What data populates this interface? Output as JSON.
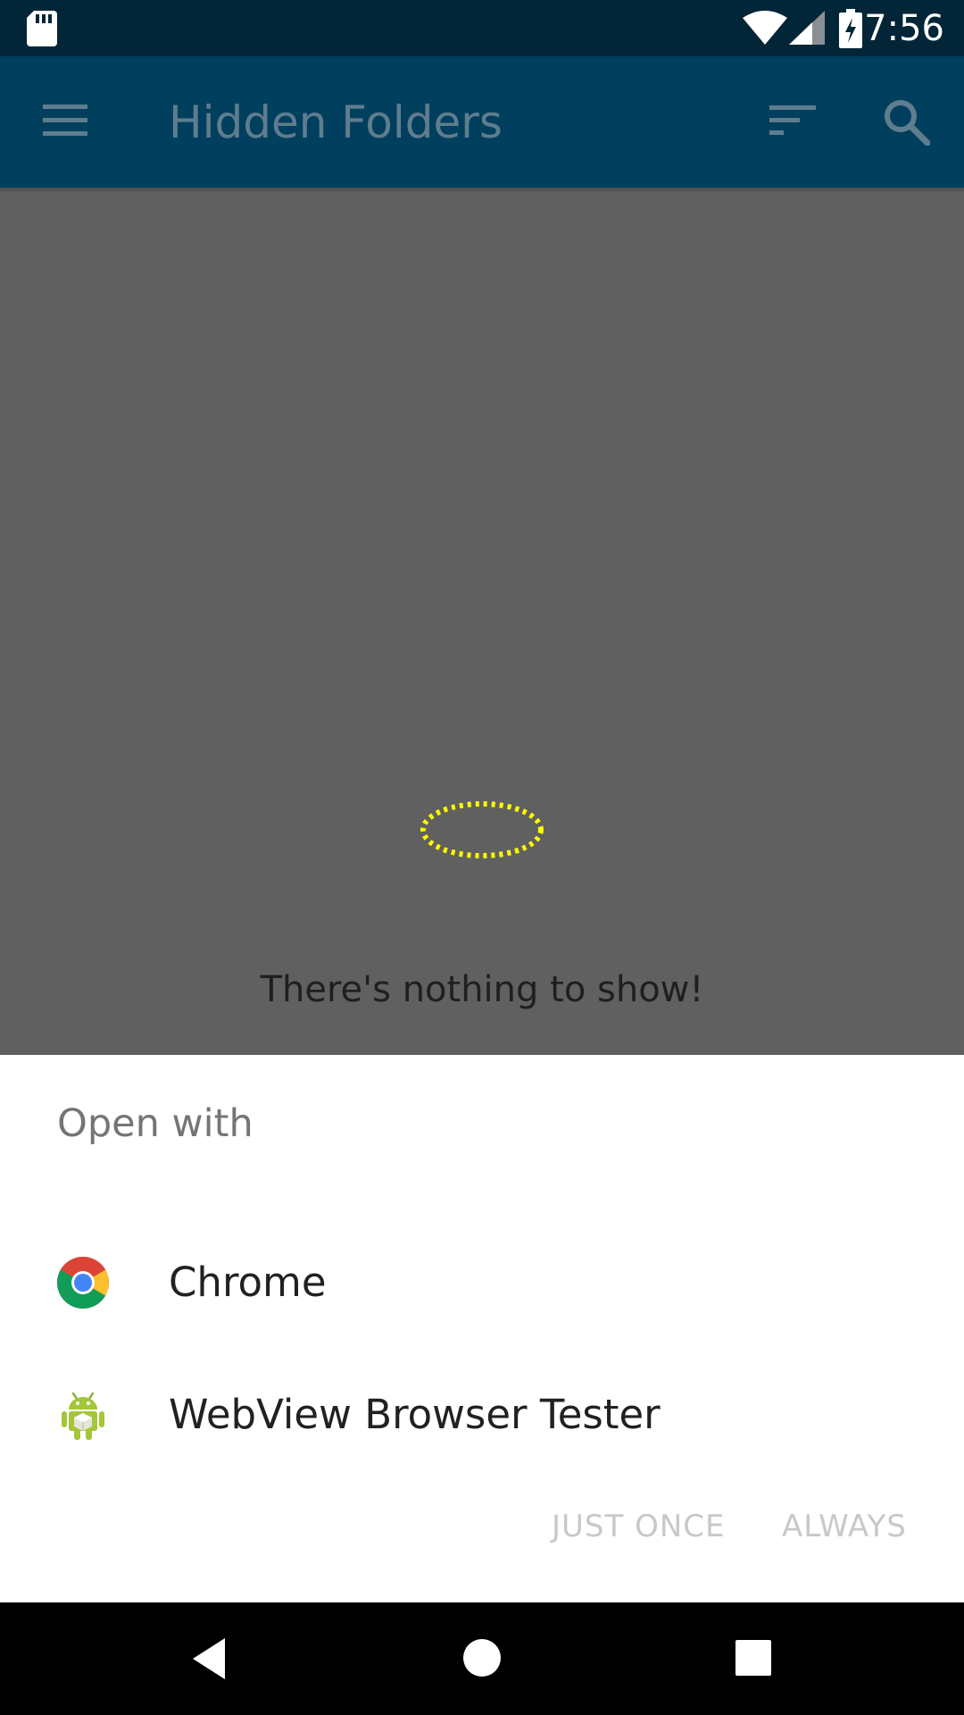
{
  "status_bar": {
    "time": "7:56",
    "icons": [
      "sd-card-icon",
      "wifi-icon",
      "signal-icon",
      "battery-charging-icon"
    ]
  },
  "app_bar": {
    "title": "Hidden Folders",
    "icons": [
      "menu-icon",
      "sort-icon",
      "search-icon"
    ]
  },
  "main": {
    "empty_message": "There's nothing to show!"
  },
  "chooser": {
    "title": "Open with",
    "apps": [
      {
        "label": "Chrome",
        "icon": "chrome-icon"
      },
      {
        "label": "WebView Browser Tester",
        "icon": "android-icon"
      }
    ],
    "buttons": {
      "just_once": "JUST ONCE",
      "always": "ALWAYS"
    }
  },
  "nav_bar": {
    "icons": [
      "back-icon",
      "home-icon",
      "recents-icon"
    ]
  },
  "colors": {
    "status_bar": "#022538",
    "app_bar": "#003f5e",
    "scrim": "#606060",
    "sheet": "#ffffff",
    "disabled_button": "#c8c8c8",
    "highlight": "#ffff00"
  }
}
